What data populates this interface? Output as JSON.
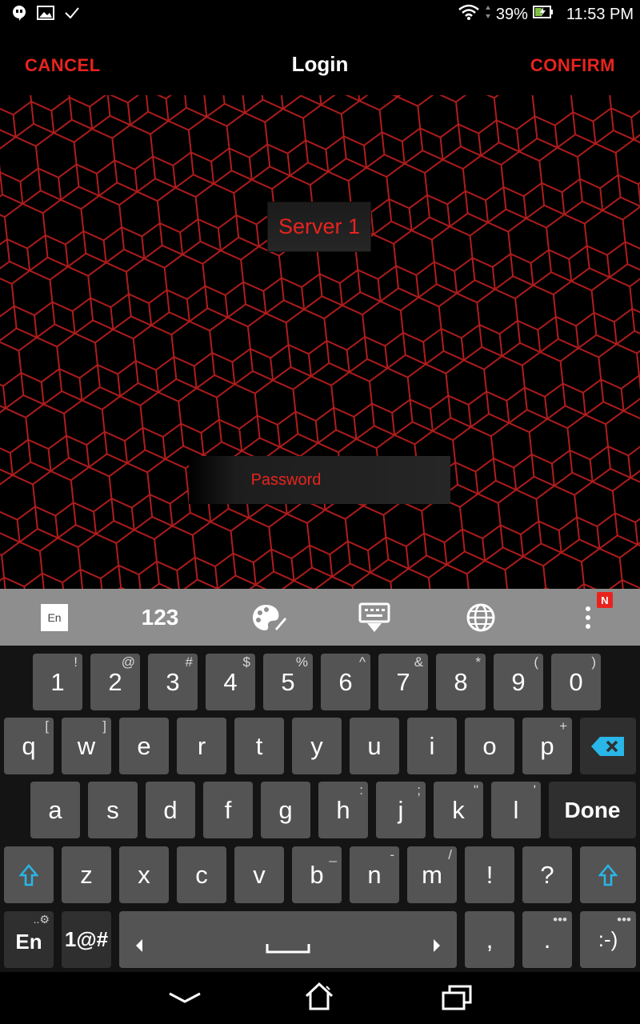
{
  "status_bar": {
    "battery": "39%",
    "time": "11:53 PM"
  },
  "action_bar": {
    "cancel": "CANCEL",
    "title": "Login",
    "confirm": "CONFIRM"
  },
  "form": {
    "server_button": "Server 1",
    "password_placeholder": "Password"
  },
  "keyboard_toolbar": {
    "language_badge": "En",
    "numbers_label": "123",
    "notification_badge": "N"
  },
  "keyboard": {
    "number_row": [
      {
        "label": "1",
        "hint": "!"
      },
      {
        "label": "2",
        "hint": "@"
      },
      {
        "label": "3",
        "hint": "#"
      },
      {
        "label": "4",
        "hint": "$"
      },
      {
        "label": "5",
        "hint": "%"
      },
      {
        "label": "6",
        "hint": "^"
      },
      {
        "label": "7",
        "hint": "&"
      },
      {
        "label": "8",
        "hint": "*"
      },
      {
        "label": "9",
        "hint": "("
      },
      {
        "label": "0",
        "hint": ")"
      }
    ],
    "row1": [
      {
        "label": "q",
        "hint": "["
      },
      {
        "label": "w",
        "hint": "]"
      },
      {
        "label": "e",
        "hint": ""
      },
      {
        "label": "r",
        "hint": ""
      },
      {
        "label": "t",
        "hint": ""
      },
      {
        "label": "y",
        "hint": ""
      },
      {
        "label": "u",
        "hint": ""
      },
      {
        "label": "i",
        "hint": ""
      },
      {
        "label": "o",
        "hint": ""
      },
      {
        "label": "p",
        "hint": "+"
      }
    ],
    "row2": [
      {
        "label": "a",
        "hint": ""
      },
      {
        "label": "s",
        "hint": ""
      },
      {
        "label": "d",
        "hint": ""
      },
      {
        "label": "f",
        "hint": ""
      },
      {
        "label": "g",
        "hint": ""
      },
      {
        "label": "h",
        "hint": ":"
      },
      {
        "label": "j",
        "hint": ";"
      },
      {
        "label": "k",
        "hint": "\""
      },
      {
        "label": "l",
        "hint": "'"
      }
    ],
    "done": "Done",
    "row3": [
      {
        "label": "z",
        "hint": ""
      },
      {
        "label": "x",
        "hint": ""
      },
      {
        "label": "c",
        "hint": ""
      },
      {
        "label": "v",
        "hint": ""
      },
      {
        "label": "b",
        "hint": "_"
      },
      {
        "label": "n",
        "hint": "-"
      },
      {
        "label": "m",
        "hint": "/"
      },
      {
        "label": "!",
        "hint": ""
      },
      {
        "label": "?",
        "hint": ""
      }
    ],
    "bottom": {
      "lang": "En",
      "symbols": "1@#",
      "comma": ",",
      "period": ".",
      "emoticon": ":-)"
    }
  },
  "colors": {
    "accent": "#e8231e",
    "hex_line": "#b01c1c",
    "key_bg": "#545454",
    "toolbar_bg": "#8e8e8e"
  }
}
